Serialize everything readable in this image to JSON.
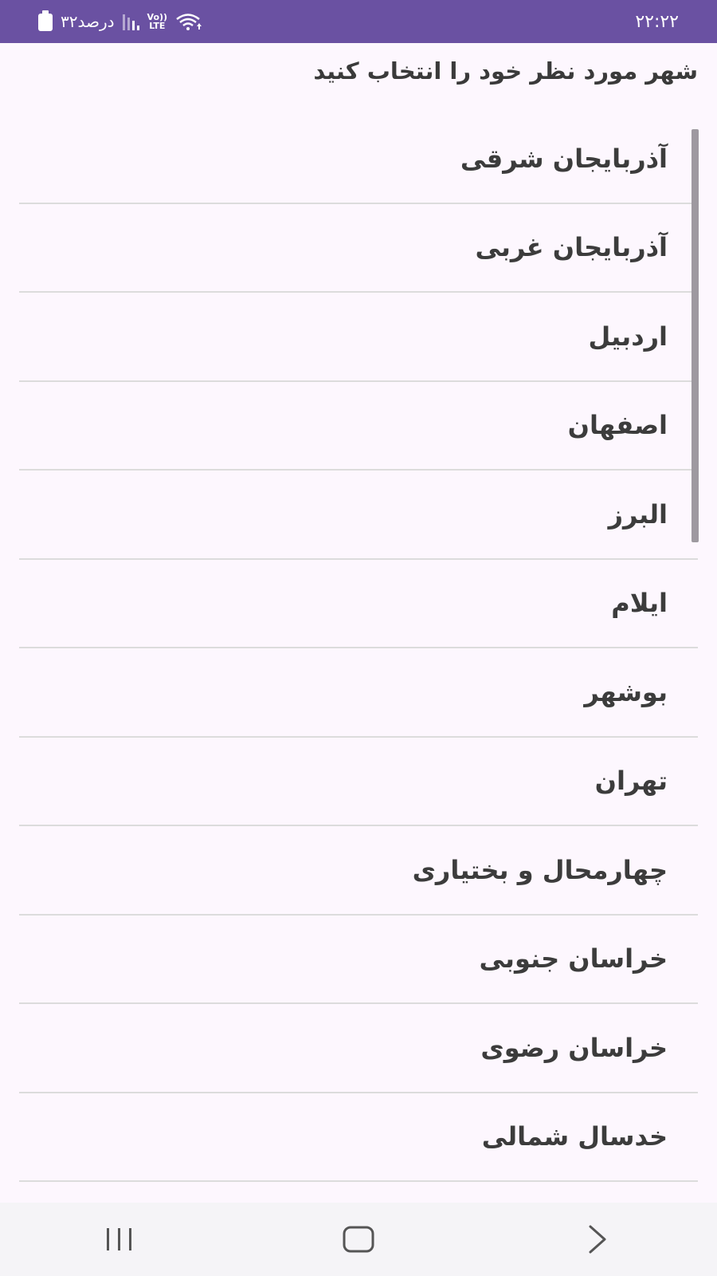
{
  "status_bar": {
    "time": "۲۲:۲۲",
    "battery_text": "۳۲درصد",
    "network_label_top": "Vo))",
    "network_label_bottom": "LTE"
  },
  "header": {
    "title": "شهر مورد نظر خود را انتخاب کنید"
  },
  "list": {
    "items": [
      {
        "label": "آذربایجان شرقی"
      },
      {
        "label": "آذربایجان غربی"
      },
      {
        "label": "اردبیل"
      },
      {
        "label": "اصفهان"
      },
      {
        "label": "البرز"
      },
      {
        "label": "ایلام"
      },
      {
        "label": "بوشهر"
      },
      {
        "label": "تهران"
      },
      {
        "label": "چهارمحال و بختیاری"
      },
      {
        "label": "خراسان جنوبی"
      },
      {
        "label": "خراسان رضوی"
      },
      {
        "label": "خدسال شمالی"
      }
    ]
  },
  "colors": {
    "status_bar_bg": "#6a51a2",
    "background": "#fdf7fe",
    "divider": "#dcdcdc",
    "nav_bar_bg": "#f5f4f7"
  },
  "icons": {
    "battery": "battery-icon",
    "signal": "signal-icon",
    "wifi": "wifi-icon",
    "recents": "recents-icon",
    "home": "home-icon",
    "back": "back-icon"
  }
}
